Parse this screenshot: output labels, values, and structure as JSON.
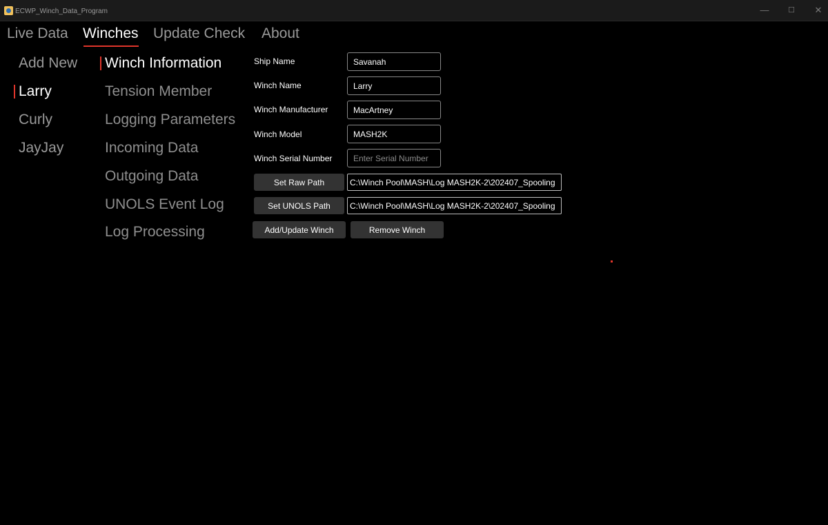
{
  "window": {
    "title": "ECWP_Winch_Data_Program",
    "controls": {
      "minimize": "—",
      "maximize": "☐",
      "close": "✕"
    }
  },
  "top_tabs": [
    {
      "label": "Live Data",
      "active": false
    },
    {
      "label": "Winches",
      "active": true
    },
    {
      "label": "Update Check",
      "active": false
    },
    {
      "label": "About",
      "active": false
    }
  ],
  "winch_list": [
    {
      "label": "Add New",
      "active": false
    },
    {
      "label": "Larry",
      "active": true
    },
    {
      "label": "Curly",
      "active": false
    },
    {
      "label": "JayJay",
      "active": false
    }
  ],
  "sub_nav": [
    {
      "label": "Winch Information",
      "active": true
    },
    {
      "label": "Tension Member",
      "active": false
    },
    {
      "label": "Logging Parameters",
      "active": false
    },
    {
      "label": "Incoming Data",
      "active": false
    },
    {
      "label": "Outgoing Data",
      "active": false
    },
    {
      "label": "UNOLS Event Log",
      "active": false
    },
    {
      "label": "Log Processing",
      "active": false
    }
  ],
  "form": {
    "ship_name": {
      "label": "Ship Name",
      "value": "Savanah",
      "placeholder": ""
    },
    "winch_name": {
      "label": "Winch Name",
      "value": "Larry",
      "placeholder": ""
    },
    "winch_manufacturer": {
      "label": "Winch Manufacturer",
      "value": "MacArtney",
      "placeholder": ""
    },
    "winch_model": {
      "label": "Winch Model",
      "value": "MASH2K",
      "placeholder": ""
    },
    "winch_serial_number": {
      "label": "Winch Serial Number",
      "value": "",
      "placeholder": "Enter Serial Number"
    },
    "raw_path": {
      "button_label": "Set Raw Path",
      "value": "C:\\Winch Pool\\MASH\\Log MASH2K-2\\202407_Spooling"
    },
    "unols_path": {
      "button_label": "Set UNOLS Path",
      "value": "C:\\Winch Pool\\MASH\\Log MASH2K-2\\202407_Spooling"
    },
    "add_update_label": "Add/Update Winch",
    "remove_label": "Remove Winch"
  },
  "colors": {
    "accent": "#e0352b",
    "background": "#000000",
    "titlebar": "#1b1b1b",
    "button": "#333333",
    "inactive_text": "#9a9a9a"
  }
}
